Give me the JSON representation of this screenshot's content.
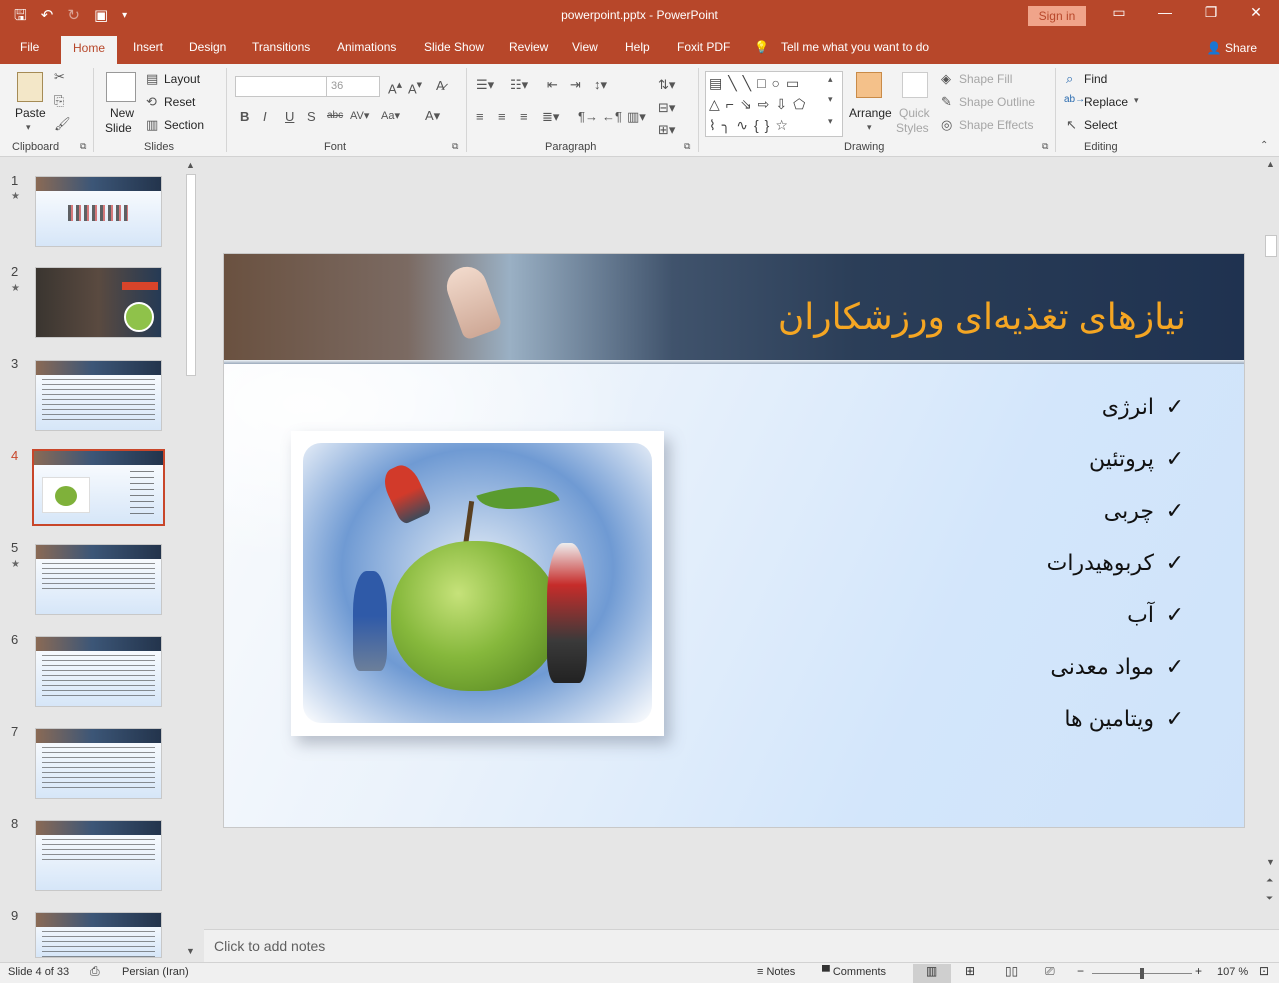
{
  "window": {
    "doc_title": "powerpoint.pptx  -  PowerPoint",
    "signin": "Sign in"
  },
  "tabs": [
    "File",
    "Home",
    "Insert",
    "Design",
    "Transitions",
    "Animations",
    "Slide Show",
    "Review",
    "View",
    "Help",
    "Foxit PDF"
  ],
  "active_tab": "Home",
  "tellme": "Tell me what you want to do",
  "share": "Share",
  "ribbon": {
    "clipboard": {
      "paste": "Paste",
      "label": "Clipboard"
    },
    "slides": {
      "new_slide": "New",
      "new_slide2": "Slide",
      "layout": "Layout",
      "reset": "Reset",
      "section": "Section",
      "label": "Slides"
    },
    "font": {
      "size": "36",
      "label": "Font"
    },
    "paragraph": {
      "label": "Paragraph"
    },
    "drawing": {
      "arrange": "Arrange",
      "quick_styles": "Quick",
      "quick_styles2": "Styles",
      "shape_fill": "Shape Fill",
      "shape_outline": "Shape Outline",
      "shape_effects": "Shape Effects",
      "label": "Drawing"
    },
    "editing": {
      "find": "Find",
      "replace": "Replace",
      "select": "Select",
      "label": "Editing"
    }
  },
  "thumbnails": [
    {
      "num": "1",
      "star": true
    },
    {
      "num": "2",
      "star": true
    },
    {
      "num": "3",
      "star": false
    },
    {
      "num": "4",
      "star": false
    },
    {
      "num": "5",
      "star": true
    },
    {
      "num": "6",
      "star": false
    },
    {
      "num": "7",
      "star": false
    },
    {
      "num": "8",
      "star": false
    },
    {
      "num": "9",
      "star": false
    }
  ],
  "selected_slide": "4",
  "slide": {
    "title": "نیازهای تغذیه‌ای ورزشکاران",
    "check": "✓",
    "bullets": [
      "انرژی",
      "پروتئین",
      "چربی",
      "کربوهیدرات",
      "آب",
      "مواد معدنی",
      "ویتامین ها"
    ]
  },
  "notes_placeholder": "Click to add notes",
  "status": {
    "slide_of": "Slide 4 of 33",
    "language": "Persian (Iran)",
    "notes": "Notes",
    "comments": "Comments",
    "zoom": "107 %"
  },
  "colors": {
    "accent": "#b7472a",
    "title": "#f5a623"
  }
}
